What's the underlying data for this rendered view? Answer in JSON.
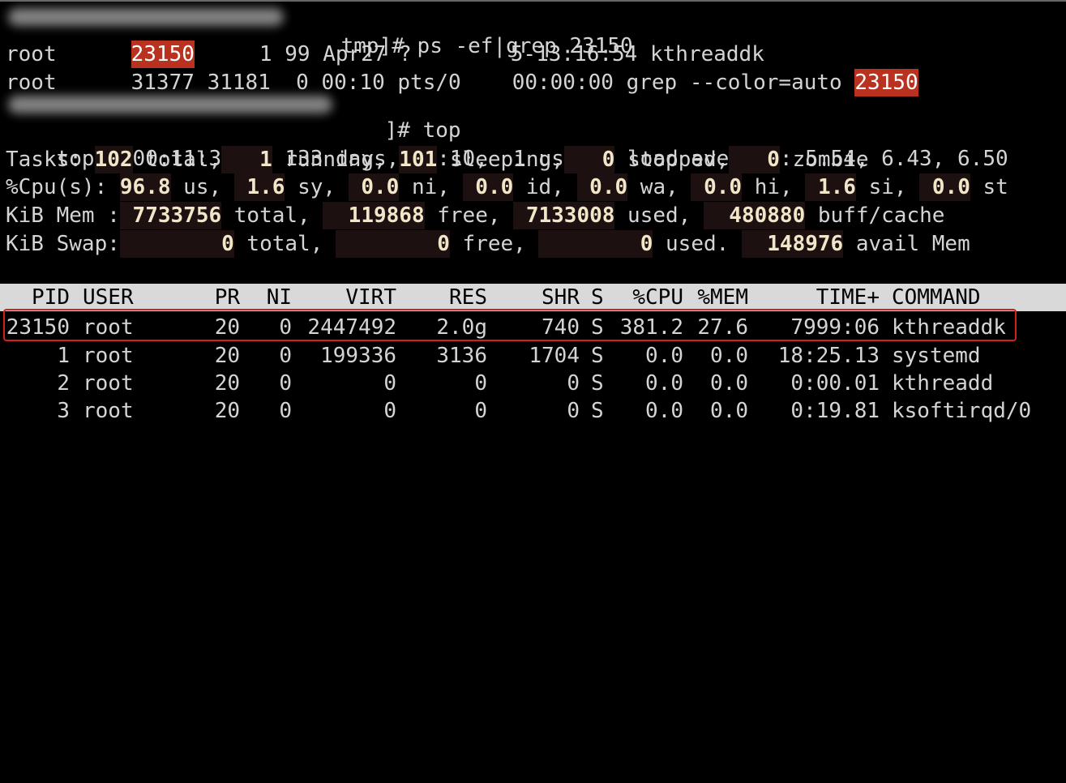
{
  "prompts": {
    "ps_prompt_tail": "tmp]# ps -ef|grep 23150",
    "top_prompt_tail": "]# top"
  },
  "ps_output": [
    {
      "user": "root",
      "pid": "23150",
      "ppid": "1",
      "c": "99",
      "stime": "Apr27",
      "tty": "?",
      "time": "5-13:16:54",
      "cmd": "kthreaddk"
    },
    {
      "user": "root",
      "pid": "31377",
      "ppid": "31181",
      "c": "0",
      "stime": "00:10",
      "tty": "pts/0",
      "time": "00:00:00",
      "cmd": "grep --color=auto",
      "match": "23150"
    }
  ],
  "summary": {
    "uptime_line": "top - 00:11:30 up 133 days,  7:10,  1 user,  load average: 5.54, 6.43, 6.50",
    "tasks": {
      "label": "Tasks:",
      "total": "102",
      "total_lbl": "total,",
      "running": "1",
      "running_lbl": "running,",
      "sleeping": "101",
      "sleeping_lbl": "sleeping,",
      "stopped": "0",
      "stopped_lbl": "stopped,",
      "zombie": "0",
      "zombie_lbl": "zombie"
    },
    "cpu": {
      "label": "%Cpu(s):",
      "us": "96.8",
      "sy": "1.6",
      "ni": "0.0",
      "id": "0.0",
      "wa": "0.0",
      "hi": "0.0",
      "si": "1.6",
      "st": "0.0"
    },
    "mem": {
      "label": "KiB Mem :",
      "total": "7733756",
      "free": "119868",
      "used": "7133008",
      "buff": "480880"
    },
    "swap": {
      "label": "KiB Swap:",
      "total": "0",
      "free": "0",
      "used": "0",
      "avail": "148976"
    }
  },
  "table": {
    "headers": {
      "pid": "PID",
      "user": "USER",
      "pr": "PR",
      "ni": "NI",
      "virt": "VIRT",
      "res": "RES",
      "shr": "SHR",
      "s": "S",
      "cpu": "%CPU",
      "mem": "%MEM",
      "time": "TIME+",
      "command": "COMMAND"
    },
    "rows": [
      {
        "pid": "23150",
        "user": "root",
        "pr": "20",
        "ni": "0",
        "virt": "2447492",
        "res": "2.0g",
        "shr": "740",
        "s": "S",
        "cpu": "381.2",
        "mem": "27.6",
        "time": "7999:06",
        "command": "kthreaddk"
      },
      {
        "pid": "1",
        "user": "root",
        "pr": "20",
        "ni": "0",
        "virt": "199336",
        "res": "3136",
        "shr": "1704",
        "s": "S",
        "cpu": "0.0",
        "mem": "0.0",
        "time": "18:25.13",
        "command": "systemd"
      },
      {
        "pid": "2",
        "user": "root",
        "pr": "20",
        "ni": "0",
        "virt": "0",
        "res": "0",
        "shr": "0",
        "s": "S",
        "cpu": "0.0",
        "mem": "0.0",
        "time": "0:00.01",
        "command": "kthreadd"
      },
      {
        "pid": "3",
        "user": "root",
        "pr": "20",
        "ni": "0",
        "virt": "0",
        "res": "0",
        "shr": "0",
        "s": "S",
        "cpu": "0.0",
        "mem": "0.0",
        "time": "0:19.81",
        "command": "ksoftirqd/0"
      }
    ]
  },
  "colors": {
    "highlight": "#b8321f",
    "header_bg": "#d9d9d9",
    "selection_border": "#d02020"
  }
}
